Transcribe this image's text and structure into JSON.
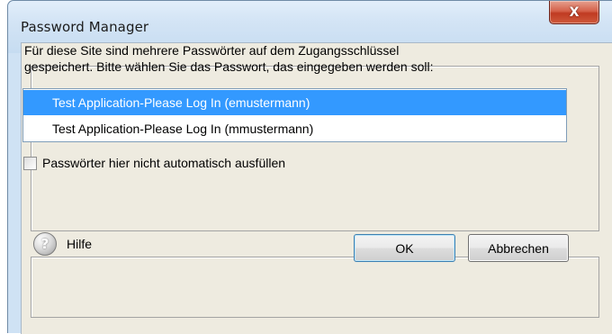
{
  "window": {
    "title": "Password Manager",
    "close_glyph": "X"
  },
  "message": {
    "line1": "Für diese Site sind mehrere Passwörter auf dem Zugangsschlüssel",
    "line2": "gespeichert. Bitte wählen Sie das Passwort, das eingegeben werden soll:"
  },
  "accounts": {
    "items": [
      {
        "label": "Test Application-Please Log In (emustermann)",
        "selected": true
      },
      {
        "label": "Test Application-Please Log In (mmustermann)",
        "selected": false
      }
    ]
  },
  "options": {
    "no_autofill_label": "Passwörter hier nicht automatisch ausfüllen",
    "no_autofill_checked": false
  },
  "footer": {
    "help_glyph": "?",
    "help_label": "Hilfe",
    "ok_label": "OK",
    "cancel_label": "Abbrechen"
  },
  "colors": {
    "selection": "#3399ff",
    "close_button": "#c03a22",
    "titlebar": "#d3e4f5"
  }
}
